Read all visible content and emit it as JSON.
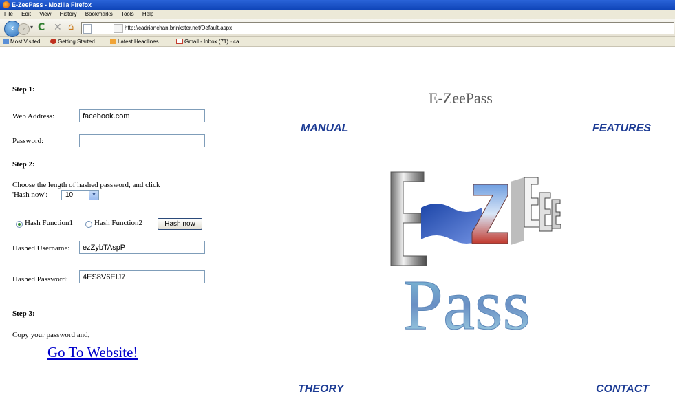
{
  "browser": {
    "window_title": "E-ZeePass - Mozilla Firefox",
    "menu": [
      "File",
      "Edit",
      "View",
      "History",
      "Bookmarks",
      "Tools",
      "Help"
    ],
    "url": "http://cadrianchan.brinkster.net/Default.aspx",
    "bookmarks": [
      "Most Visited",
      "Getting Started",
      "Latest Headlines",
      "Gmail - Inbox (71) - ca..."
    ]
  },
  "page": {
    "brand_title": "E-ZeePass",
    "nav": {
      "manual": "MANUAL",
      "features": "FEATURES",
      "theory": "THEORY",
      "contact": "CONTACT"
    },
    "step1": {
      "heading": "Step 1:",
      "web_address_label": "Web Address:",
      "web_address_value": "facebook.com",
      "password_label": "Password:",
      "password_value": ""
    },
    "step2": {
      "heading": "Step 2:",
      "instruction_line1": "Choose the length of hashed password, and click",
      "instruction_line2": "'Hash now':",
      "length_value": "10",
      "radio1_label": "Hash Function1",
      "radio2_label": "Hash Function2",
      "radio_selected": "Hash Function1",
      "hash_button": "Hash now",
      "hashed_username_label": "Hashed Username:",
      "hashed_username_value": "ezZybTAspP",
      "hashed_password_label": "Hashed Password:",
      "hashed_password_value": "4ES8V6EIJ7"
    },
    "step3": {
      "heading": "Step 3:",
      "instruction": "Copy your password and,",
      "link": "Go To Website!"
    },
    "logo": {
      "line1": "E ZEE",
      "line2": "Pass"
    }
  }
}
